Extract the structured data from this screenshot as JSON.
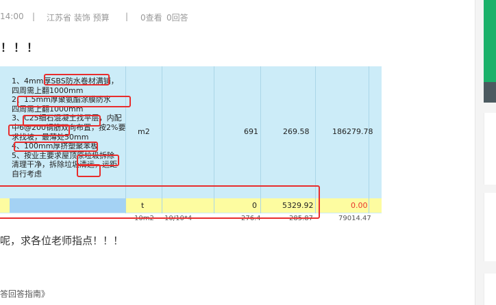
{
  "meta": {
    "time": "14:00",
    "sep1": "|",
    "tags": "江苏省  装饰 预算",
    "sep2": "|",
    "views": "0查看",
    "answers": "0回答"
  },
  "title_fragment": "！！！",
  "screenshot_table": {
    "spec_lines": [
      "1、4mm厚SBS防水卷材满铺，",
      "四周需上翻1000mm",
      "2、1.5mm厚聚氨酯涂膜防水",
      "四周需上翻1000mm",
      "3、C25细石混凝土找平层，内配",
      "中6@200钢筋双向布置，按2%要",
      "求找坡，最薄处50mm",
      "4、100mm厚挤塑聚苯板",
      "5、按业主要求屋顶原垃圾拆除",
      "清理干净，拆除垃圾清运，运距",
      "自行考虑"
    ],
    "row1": {
      "unit": "m2",
      "qty": "691",
      "price": "269.58",
      "total": "186279.78"
    },
    "row2": {
      "unit": "t",
      "qty": "0",
      "price": "5329.92",
      "total": "0.00"
    },
    "row3_cut": {
      "unit": "10m2",
      "code": "10/10*4",
      "qty": "276.4",
      "price": "285.87",
      "total": "79014.47"
    },
    "colors": {
      "table_bg": "#ccecf8",
      "highlight_row": "#fdfca0",
      "selected_cell": "#a4d2f4",
      "red_total": "#e8352c",
      "annotation": "#e82c2c"
    }
  },
  "question_text": "呢，求各位老师指点！！！",
  "guide_link": "答回答指南》",
  "sidebar": {
    "accent": "#1bb16a"
  }
}
